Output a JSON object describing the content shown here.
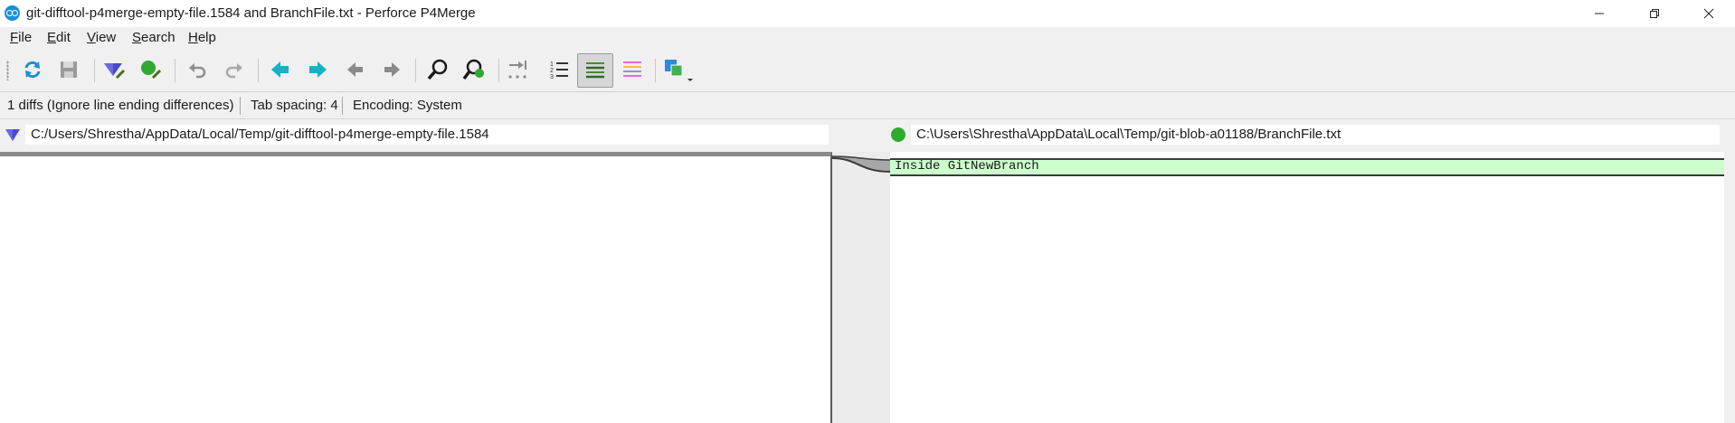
{
  "window": {
    "title": "git-difftool-p4merge-empty-file.1584 and BranchFile.txt - Perforce P4Merge",
    "app_icon": "p4merge-logo-icon",
    "controls": [
      "minimize-icon",
      "maximize-icon",
      "close-icon"
    ]
  },
  "menu": {
    "items": [
      {
        "first": "F",
        "rest": "ile"
      },
      {
        "first": "E",
        "rest": "dit"
      },
      {
        "first": "V",
        "rest": "iew"
      },
      {
        "first": "S",
        "rest": "earch"
      },
      {
        "first": "H",
        "rest": "elp"
      }
    ]
  },
  "toolbar": {
    "buttons": [
      "refresh-icon",
      "save-icon",
      "left-file-marker-icon",
      "right-file-marker-icon",
      "undo-icon",
      "redo-icon",
      "previous-diff-icon",
      "next-diff-icon",
      "previous-change-icon",
      "next-change-icon",
      "find-icon",
      "find-next-icon",
      "show-tab-whitespace-icon",
      "line-numbers-icon",
      "diff-inline-icon",
      "diff-highlight-icon",
      "layout-icon"
    ],
    "active_button": "diff-inline-icon"
  },
  "status": {
    "diffs": "1 diffs (Ignore line ending differences)",
    "tab_spacing": "Tab spacing: 4",
    "encoding": "Encoding: System"
  },
  "files": {
    "left": {
      "path": "C:/Users/Shrestha/AppData/Local/Temp/git-difftool-p4merge-empty-file.1584",
      "marker_color": "#4b4bc8"
    },
    "right": {
      "path": "C:\\Users\\Shrestha\\AppData\\Local\\Temp/git-blob-a01188/BranchFile.txt",
      "marker_color": "#2eaa2e"
    }
  },
  "content": {
    "left_lines": [],
    "right_lines": [
      "Inside GitNewBranch"
    ]
  },
  "colors": {
    "added_line_bg": "#cdffcd",
    "accent": "#1b8fd6"
  }
}
